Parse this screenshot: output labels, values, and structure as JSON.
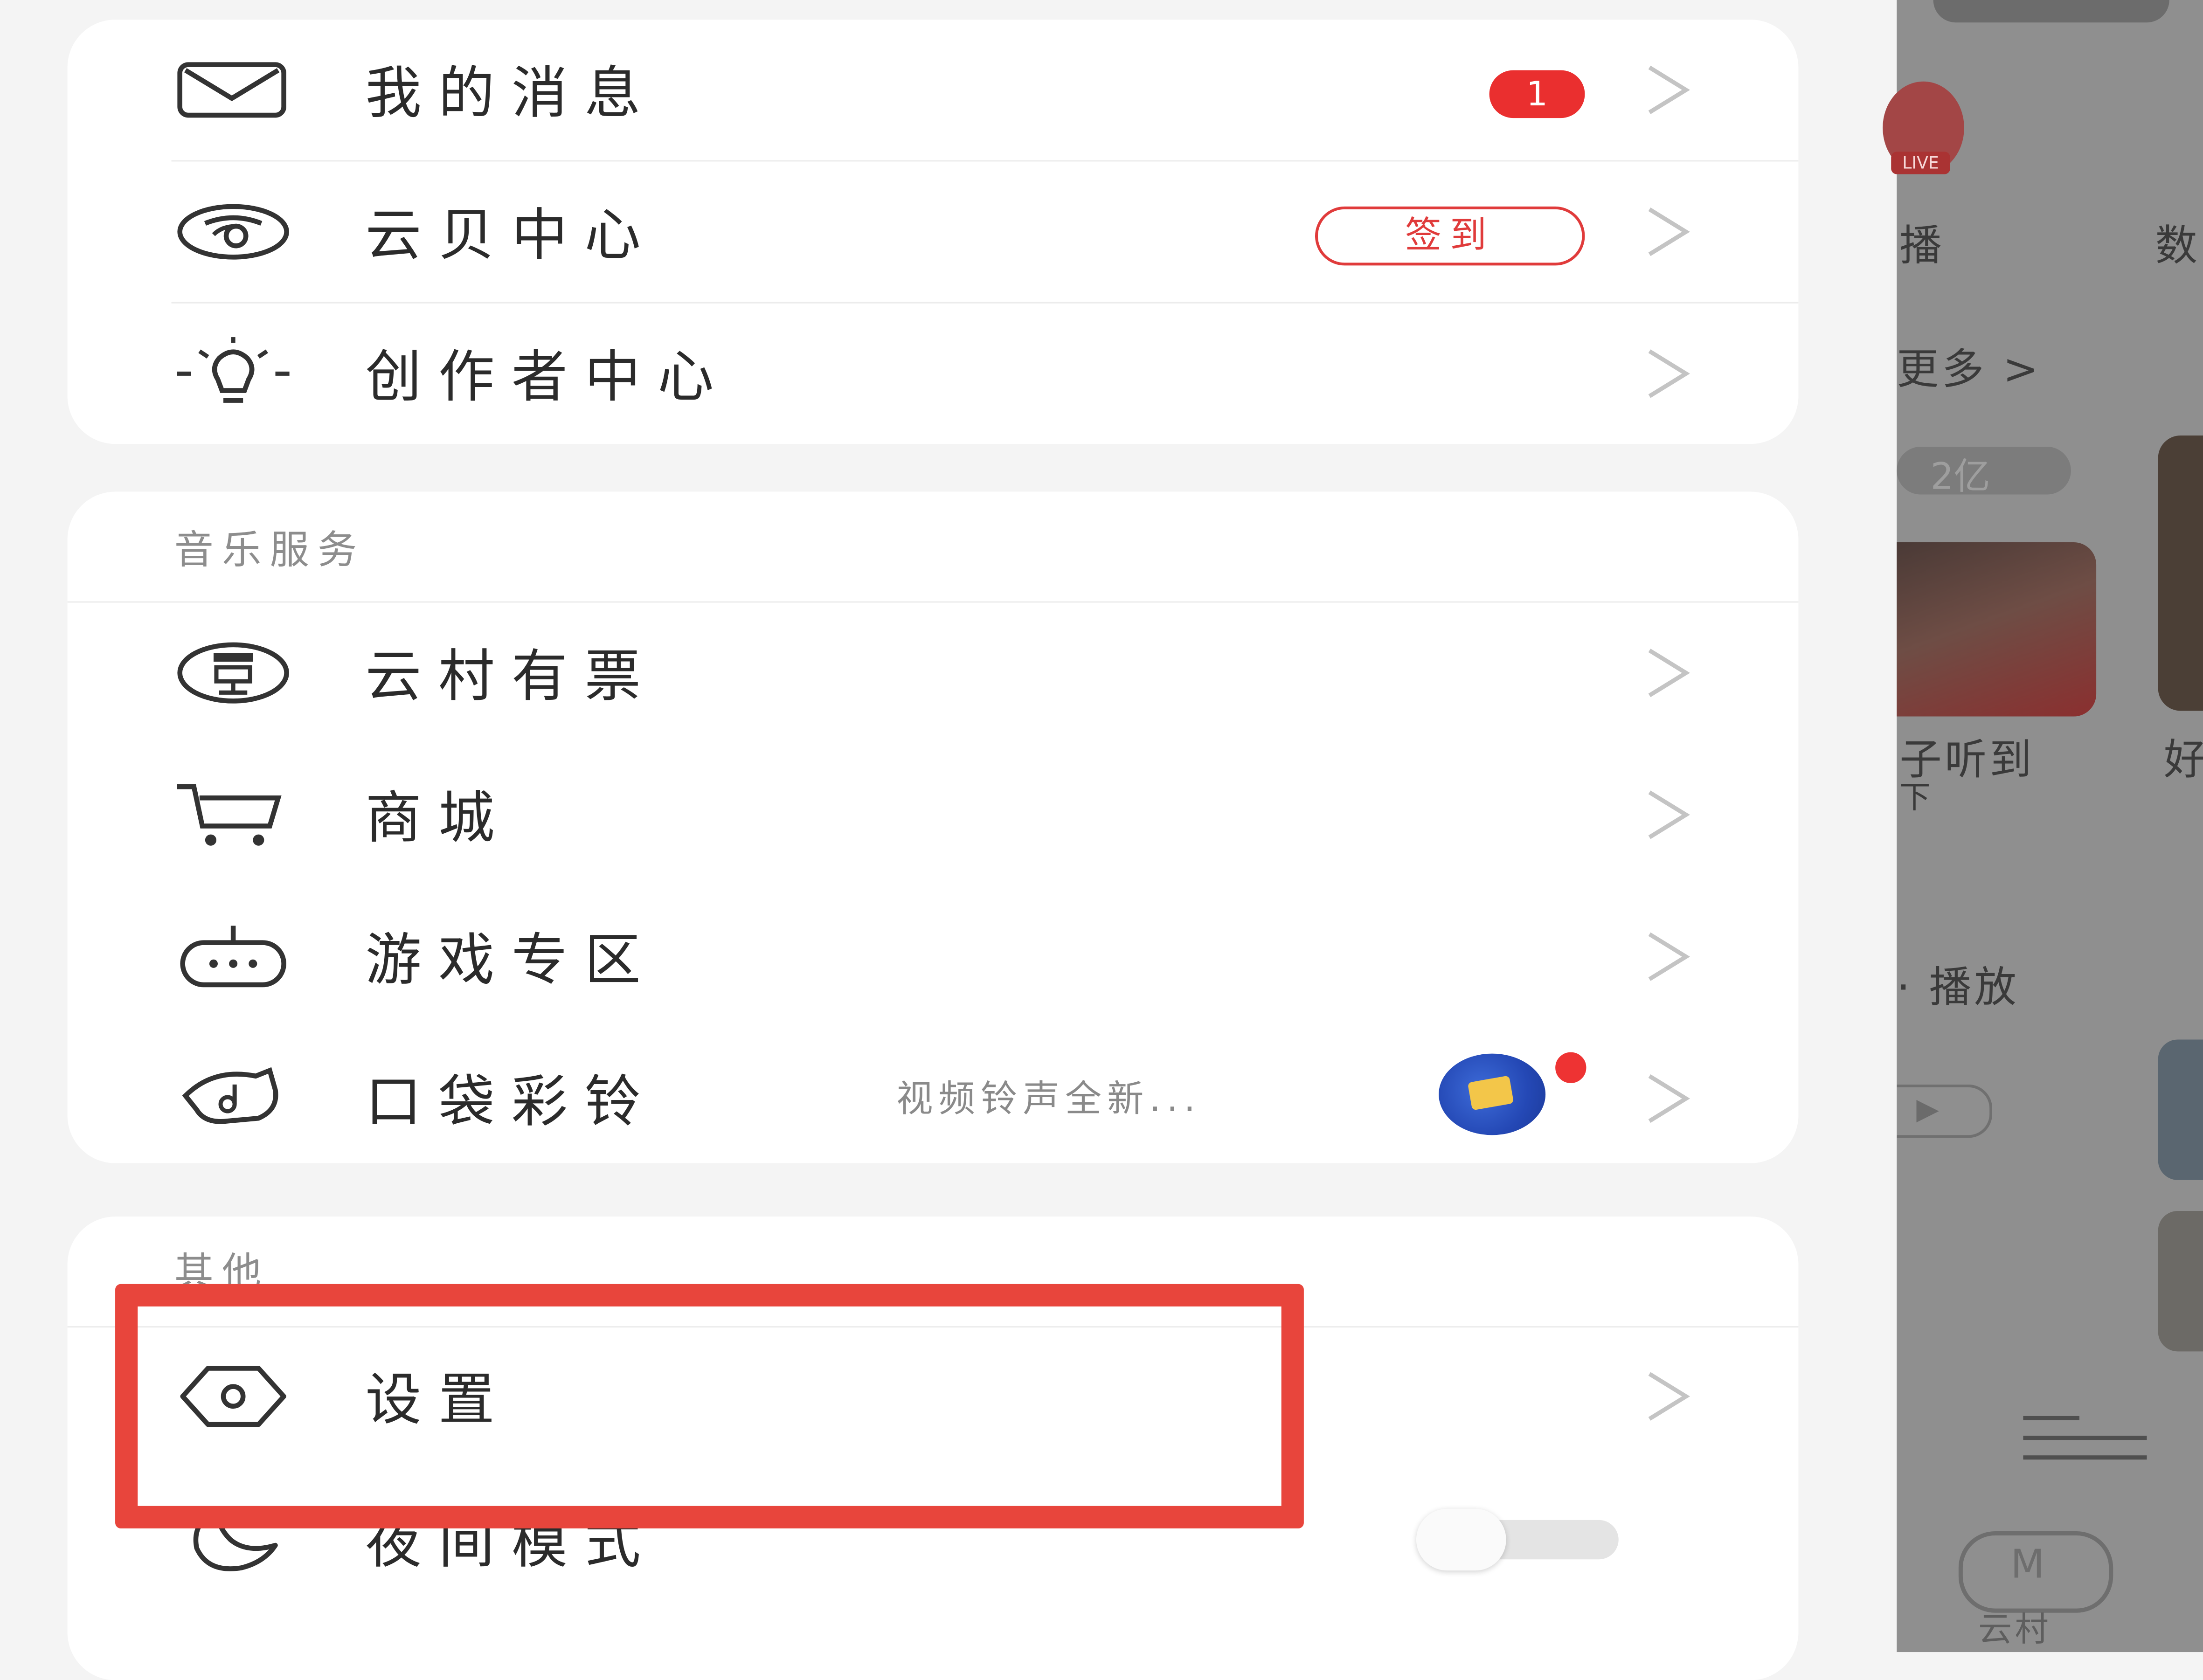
{
  "menu_card": {
    "items": [
      {
        "label": "我的消息",
        "icon": "mail-icon",
        "badge": "1"
      },
      {
        "label": "云贝中心",
        "icon": "yunbei-icon",
        "action_label": "签到"
      },
      {
        "label": "创作者中心",
        "icon": "lightbulb-icon"
      }
    ]
  },
  "music_services": {
    "title": "音乐服务",
    "items": [
      {
        "label": "云村有票",
        "icon": "ticket-icon"
      },
      {
        "label": "商城",
        "icon": "cart-icon"
      },
      {
        "label": "游戏专区",
        "icon": "gamepad-icon"
      },
      {
        "label": "口袋彩铃",
        "icon": "ringtone-icon",
        "hint": "视频铃声全新..."
      }
    ]
  },
  "other": {
    "title": "其他",
    "items": [
      {
        "label": "设置",
        "icon": "settings-icon"
      },
      {
        "label": "夜间模式",
        "icon": "moon-icon",
        "toggle_on": false
      }
    ]
  },
  "background_app": {
    "live_tag": "LIVE",
    "texts": [
      "播",
      "数",
      "更多 >",
      "2亿",
      "子听到",
      "好",
      "下",
      "· 播放",
      "云村"
    ]
  },
  "colors": {
    "accent_red": "#e8453c",
    "badge_red": "#ea2f2f",
    "highlight_box": "#e8453c"
  }
}
